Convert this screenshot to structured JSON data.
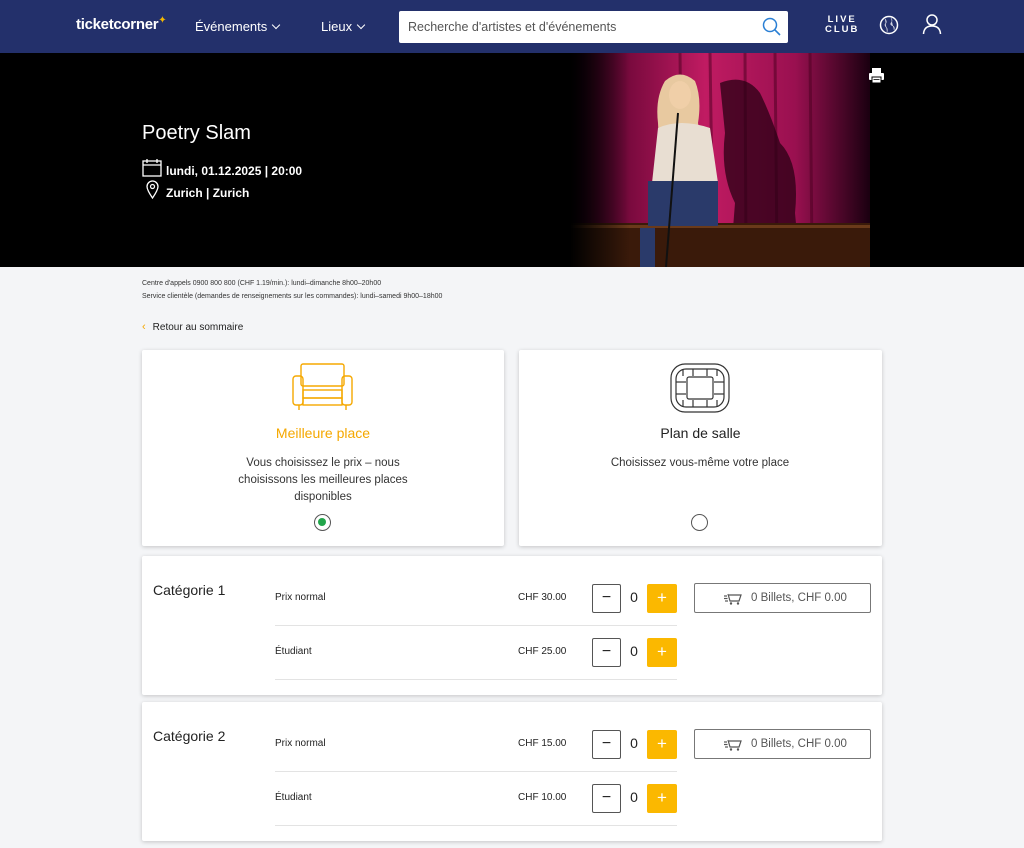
{
  "nav": {
    "logo": "ticketcorner",
    "logo_star": "✦",
    "events": "Événements",
    "venues": "Lieux",
    "search_placeholder": "Recherche d'artistes et d'événements",
    "live_club_line1": "LIVE",
    "live_club_line2": "CLUB"
  },
  "event": {
    "title": "Poetry Slam",
    "date": "lundi, 01.12.2025 | 20:00",
    "venue": "Zurich | Zurich"
  },
  "info": {
    "call_center": "Centre d'appels 0900 800 800 (CHF 1.19/min.): lundi–dimanche 8h00–20h00",
    "customer_service": "Service clientèle (demandes de renseignements sur les commandes): lundi–samedi 9h00–18h00"
  },
  "back_link": "Retour au sommaire",
  "options": [
    {
      "title": "Meilleure place",
      "description": "Vous choisissez le prix – nous choisissons les meilleures places disponibles",
      "selected": true
    },
    {
      "title": "Plan de salle",
      "description": "Choisissez vous-même votre place",
      "selected": false
    }
  ],
  "categories": [
    {
      "name": "Catégorie 1",
      "cart": "0 Billets, CHF 0.00",
      "rows": [
        {
          "label": "Prix normal",
          "price": "CHF 30.00",
          "qty": "0"
        },
        {
          "label": "Étudiant",
          "price": "CHF 25.00",
          "qty": "0"
        }
      ]
    },
    {
      "name": "Catégorie 2",
      "cart": "0 Billets, CHF 0.00",
      "rows": [
        {
          "label": "Prix normal",
          "price": "CHF 15.00",
          "qty": "0"
        },
        {
          "label": "Étudiant",
          "price": "CHF 10.00",
          "qty": "0"
        }
      ]
    }
  ],
  "buttons": {
    "minus": "−",
    "plus": "+"
  },
  "colors": {
    "nav_bg": "#23306b",
    "accent": "#fbb800",
    "selected_option": "#f5a800",
    "radio_checked": "#22a54b"
  }
}
